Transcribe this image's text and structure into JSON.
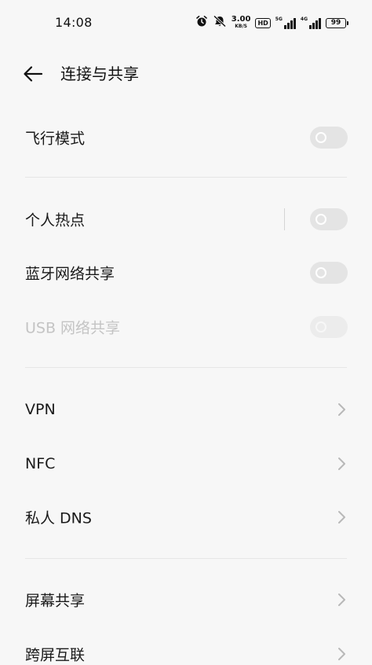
{
  "status_bar": {
    "time": "14:08",
    "net_speed_value": "3.00",
    "net_speed_unit": "KB/S",
    "hd_label": "HD",
    "signal_1_label": "5G",
    "signal_2_label": "4G",
    "battery_level": "99",
    "icons": [
      "alarm-icon",
      "mute-icon",
      "hd-icon",
      "signal-icon",
      "signal-icon",
      "battery-icon"
    ]
  },
  "header": {
    "title": "连接与共享",
    "back_icon": "arrow-left-icon"
  },
  "settings": {
    "airplane_mode": {
      "label": "飞行模式",
      "enabled": false
    },
    "hotspot": {
      "label": "个人热点",
      "enabled": false
    },
    "bluetooth_tethering": {
      "label": "蓝牙网络共享",
      "enabled": false
    },
    "usb_tethering": {
      "label": "USB 网络共享",
      "enabled": false,
      "disabled": true
    },
    "vpn": {
      "label": "VPN"
    },
    "nfc": {
      "label": "NFC"
    },
    "private_dns": {
      "label": "私人 DNS"
    },
    "screen_sharing": {
      "label": "屏幕共享"
    },
    "cross_screen": {
      "label": "跨屏互联"
    }
  },
  "colors": {
    "background": "#f7f7f7",
    "toggle_off": "#e4e4e4",
    "text_primary": "#1a1a1a",
    "text_disabled": "#c4c4c4",
    "divider": "#e6e6e6",
    "chevron": "#b8b8b8"
  }
}
